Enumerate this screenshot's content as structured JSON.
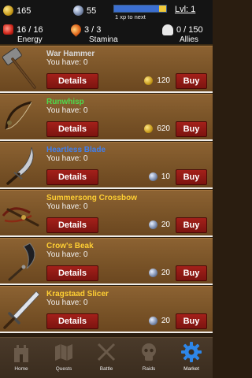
{
  "hud": {
    "gold": "165",
    "gems": "55",
    "xp_text": "1 xp to next",
    "xp_progress": 0.87,
    "level": "Lvl: 1",
    "energy": "16 / 16",
    "stamina": "3 / 3",
    "allies": "0 / 150",
    "energy_label": "Energy",
    "stamina_label": "Stamina",
    "allies_label": "Allies"
  },
  "items": [
    {
      "name": "War Hammer",
      "name_color": "#d8d8d8",
      "have": "You have: 0",
      "details": "Details",
      "price": "120",
      "currency": "gold",
      "buy": "Buy",
      "icon": "war-hammer-icon"
    },
    {
      "name": "Runwhisp",
      "name_color": "#4ddb4d",
      "have": "You have: 0",
      "details": "Details",
      "price": "620",
      "currency": "gold",
      "buy": "Buy",
      "icon": "bow-icon"
    },
    {
      "name": "Heartless Blade",
      "name_color": "#3f7ff0",
      "have": "You have: 0",
      "details": "Details",
      "price": "10",
      "currency": "gem",
      "buy": "Buy",
      "icon": "curved-blade-icon"
    },
    {
      "name": "Summersong Crossbow",
      "name_color": "#ffcf33",
      "have": "You have: 0",
      "details": "Details",
      "price": "20",
      "currency": "gem",
      "buy": "Buy",
      "icon": "crossbow-icon"
    },
    {
      "name": "Crow's Beak",
      "name_color": "#ffcf33",
      "have": "You have: 0",
      "details": "Details",
      "price": "20",
      "currency": "gem",
      "buy": "Buy",
      "icon": "sickle-icon"
    },
    {
      "name": "Kragstaad Slicer",
      "name_color": "#ffcf33",
      "have": "You have: 0",
      "details": "Details",
      "price": "20",
      "currency": "gem",
      "buy": "Buy",
      "icon": "sword-icon"
    }
  ],
  "nav": [
    {
      "label": "Home",
      "icon": "castle-icon",
      "active": false
    },
    {
      "label": "Quests",
      "icon": "map-icon",
      "active": false
    },
    {
      "label": "Battle",
      "icon": "crossed-swords-icon",
      "active": false
    },
    {
      "label": "Raids",
      "icon": "skull-icon",
      "active": false
    },
    {
      "label": "Market",
      "icon": "gear-icon",
      "active": true
    }
  ]
}
